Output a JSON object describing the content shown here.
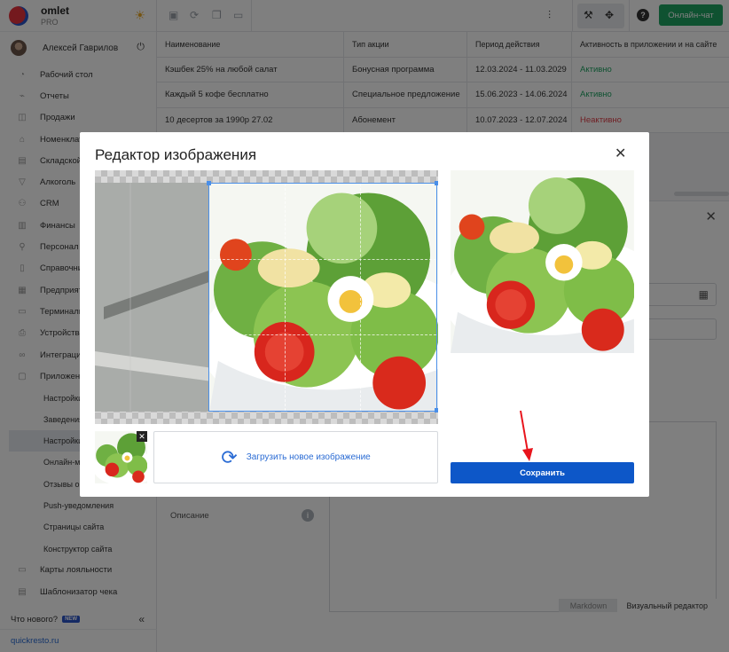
{
  "brand": {
    "name": "omlet",
    "plan": "PRO"
  },
  "user": {
    "name": "Алексей Гаврилов"
  },
  "sidebar": {
    "items": [
      {
        "label": "Рабочий стол",
        "icon": "dashboard-icon"
      },
      {
        "label": "Отчеты",
        "icon": "chart-icon"
      },
      {
        "label": "Продажи",
        "icon": "sales-icon"
      },
      {
        "label": "Номенклатура",
        "icon": "tag-icon"
      },
      {
        "label": "Складской учет",
        "icon": "box-icon"
      },
      {
        "label": "Алкоголь",
        "icon": "glass-icon"
      },
      {
        "label": "CRM",
        "icon": "people-icon"
      },
      {
        "label": "Финансы",
        "icon": "wallet-icon"
      },
      {
        "label": "Персонал",
        "icon": "person-icon"
      },
      {
        "label": "Справочники",
        "icon": "book-icon"
      },
      {
        "label": "Предприятия",
        "icon": "building-icon"
      },
      {
        "label": "Терминалы",
        "icon": "terminal-icon"
      },
      {
        "label": "Устройства",
        "icon": "printer-icon"
      },
      {
        "label": "Интеграции",
        "icon": "link-icon"
      },
      {
        "label": "Приложения",
        "icon": "app-icon"
      }
    ],
    "subitems": [
      {
        "label": "Настройки"
      },
      {
        "label": "Заведения"
      },
      {
        "label": "Настройки",
        "active": true
      },
      {
        "label": "Онлайн-меню"
      },
      {
        "label": "Отзывы о заведении"
      },
      {
        "label": "Push-уведомления"
      },
      {
        "label": "Страницы сайта"
      },
      {
        "label": "Конструктор сайта"
      }
    ],
    "bottom_items": [
      {
        "label": "Карты лояльности",
        "icon": "card-icon"
      },
      {
        "label": "Шаблонизатор чека",
        "icon": "receipt-icon"
      }
    ],
    "whats_new": "Что нового?",
    "new_badge": "NEW",
    "site_link": "quickresto.ru"
  },
  "topbar": {
    "chat_label": "Онлайн-чат",
    "help": "?"
  },
  "table": {
    "headers": [
      "Наименование",
      "Тип акции",
      "Период действия",
      "Активность в приложении и на сайте"
    ],
    "rows": [
      {
        "name": "Кэшбек 25% на любой салат",
        "type": "Бонусная программа",
        "period": "12.03.2024 - 11.03.2029",
        "status": "Активно",
        "active": true
      },
      {
        "name": "Каждый 5 кофе бесплатно",
        "type": "Специальное предложение",
        "period": "15.06.2023 - 14.06.2024",
        "status": "Активно",
        "active": true
      },
      {
        "name": "10 десертов за 1990р 27.02",
        "type": "Абонемент",
        "period": "10.07.2023 - 12.07.2024",
        "status": "Неактивно",
        "active": false
      }
    ]
  },
  "panel": {
    "description_label": "Описание",
    "info": "i",
    "tab_markdown": "Markdown",
    "tab_visual": "Визуальный редактор"
  },
  "modal": {
    "title": "Редактор изображения",
    "upload_label": "Загрузить новое изображение",
    "save_label": "Сохранить"
  },
  "colors": {
    "accent": "#0d57c8",
    "chat": "#1fa463",
    "active": "#1fa463",
    "inactive": "#e0404a",
    "annotation_arrow": "#e8141c"
  }
}
